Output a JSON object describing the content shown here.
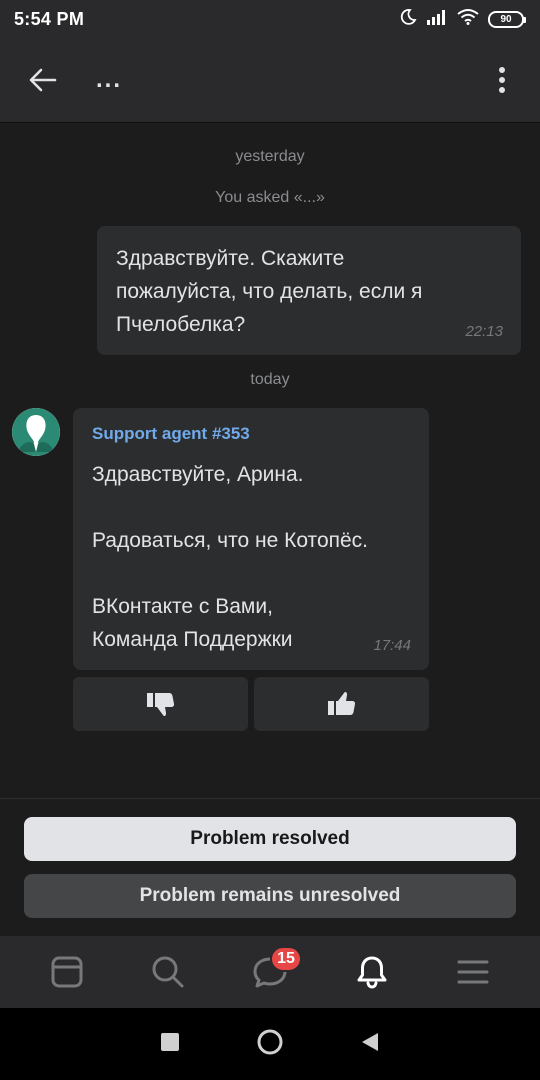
{
  "status_bar": {
    "time": "5:54 PM",
    "battery": "90",
    "icons": [
      "moon-icon",
      "signal-icon",
      "wifi-icon",
      "battery-icon"
    ]
  },
  "top_bar": {
    "title": "...",
    "icons": [
      "back-arrow-icon",
      "more-vertical-icon"
    ]
  },
  "chat": {
    "date_yesterday": "yesterday",
    "you_asked": "You asked «...»",
    "user_message": {
      "text": "Здравствуйте. Скажите\nпожалуйста, что делать, если я\nПчелобелка?",
      "time": "22:13"
    },
    "date_today": "today",
    "agent_message": {
      "name": "Support agent #353",
      "text": "Здравствуйте, Арина.\n\nРадоваться, что не Котопёс.\n\nВКонтакте с Вами,\nКоманда Поддержки",
      "time": "17:44"
    },
    "rating_icons": [
      "thumbs-down-icon",
      "thumbs-up-icon"
    ]
  },
  "actions": {
    "resolved": "Problem resolved",
    "unresolved": "Problem remains unresolved"
  },
  "tab_bar": {
    "items": [
      "news-tab",
      "search-tab",
      "messages-tab",
      "notifications-tab",
      "menu-tab"
    ],
    "messages_badge": "15"
  },
  "nav_bar": {
    "icons": [
      "recents-square-icon",
      "home-circle-icon",
      "back-triangle-icon"
    ]
  },
  "colors": {
    "background": "#1c1c1d",
    "bubble": "#2c2d2e",
    "accent_link": "#71aaeb",
    "badge": "#e64646",
    "avatar_accent": "#2a8a74"
  }
}
